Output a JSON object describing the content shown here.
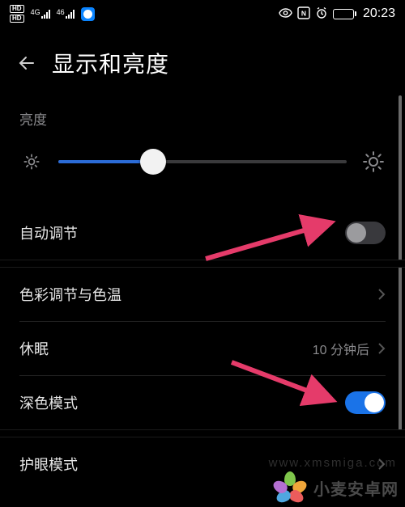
{
  "status": {
    "hd1": "HD",
    "hd2": "HD",
    "sig4g": "4G",
    "sig46": "46",
    "time": "20:23"
  },
  "header": {
    "title": "显示和亮度"
  },
  "brightness": {
    "label": "亮度",
    "percent": 33
  },
  "rows": {
    "auto": {
      "label": "自动调节",
      "on": false
    },
    "color": {
      "label": "色彩调节与色温"
    },
    "sleep": {
      "label": "休眠",
      "value": "10 分钟后"
    },
    "dark": {
      "label": "深色模式",
      "on": true
    },
    "eye": {
      "label": "护眼模式"
    }
  },
  "watermark": {
    "text": "小麦安卓网",
    "url": "www.xmsmiga.com"
  }
}
